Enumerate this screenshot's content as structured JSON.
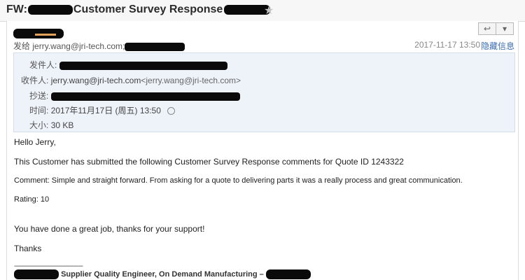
{
  "subject": {
    "prefix": "FW:",
    "title": "Customer Survey Response"
  },
  "header": {
    "to_label": "发给",
    "to_address": "jerry.wang@jri-tech.com;",
    "date": "2017-11-17 13:50",
    "hide_info": "隐藏信息"
  },
  "details": {
    "from_label": "发件人:",
    "recipient_label": "收件人:",
    "recipient_value": "jerry.wang@jri-tech.com",
    "recipient_email": "<jerry.wang@jri-tech.com>",
    "cc_label": "抄送:",
    "time_label": "时间:",
    "time_value": "2017年11月17日 (周五) 13:50",
    "size_label": "大小:",
    "size_value": "30 KB"
  },
  "body": {
    "greeting": "Hello Jerry,",
    "line1": "This Customer has submitted the following Customer Survey Response comments for Quote ID 1243322",
    "comment": "Comment: Simple and straight forward. From asking for a quote to delivering parts it was a really process and great communication.",
    "rating": "Rating: 10",
    "line2": "You have done a great job, thanks for your support!",
    "thanks": "Thanks",
    "sig_dashes": "------------------------------------------",
    "signature": "Supplier Quality Engineer, On Demand Manufacturing –"
  },
  "colors": {
    "accent_link": "#3b6db0",
    "details_bg": "#eef3fa",
    "redaction": "#0a0a0a"
  }
}
